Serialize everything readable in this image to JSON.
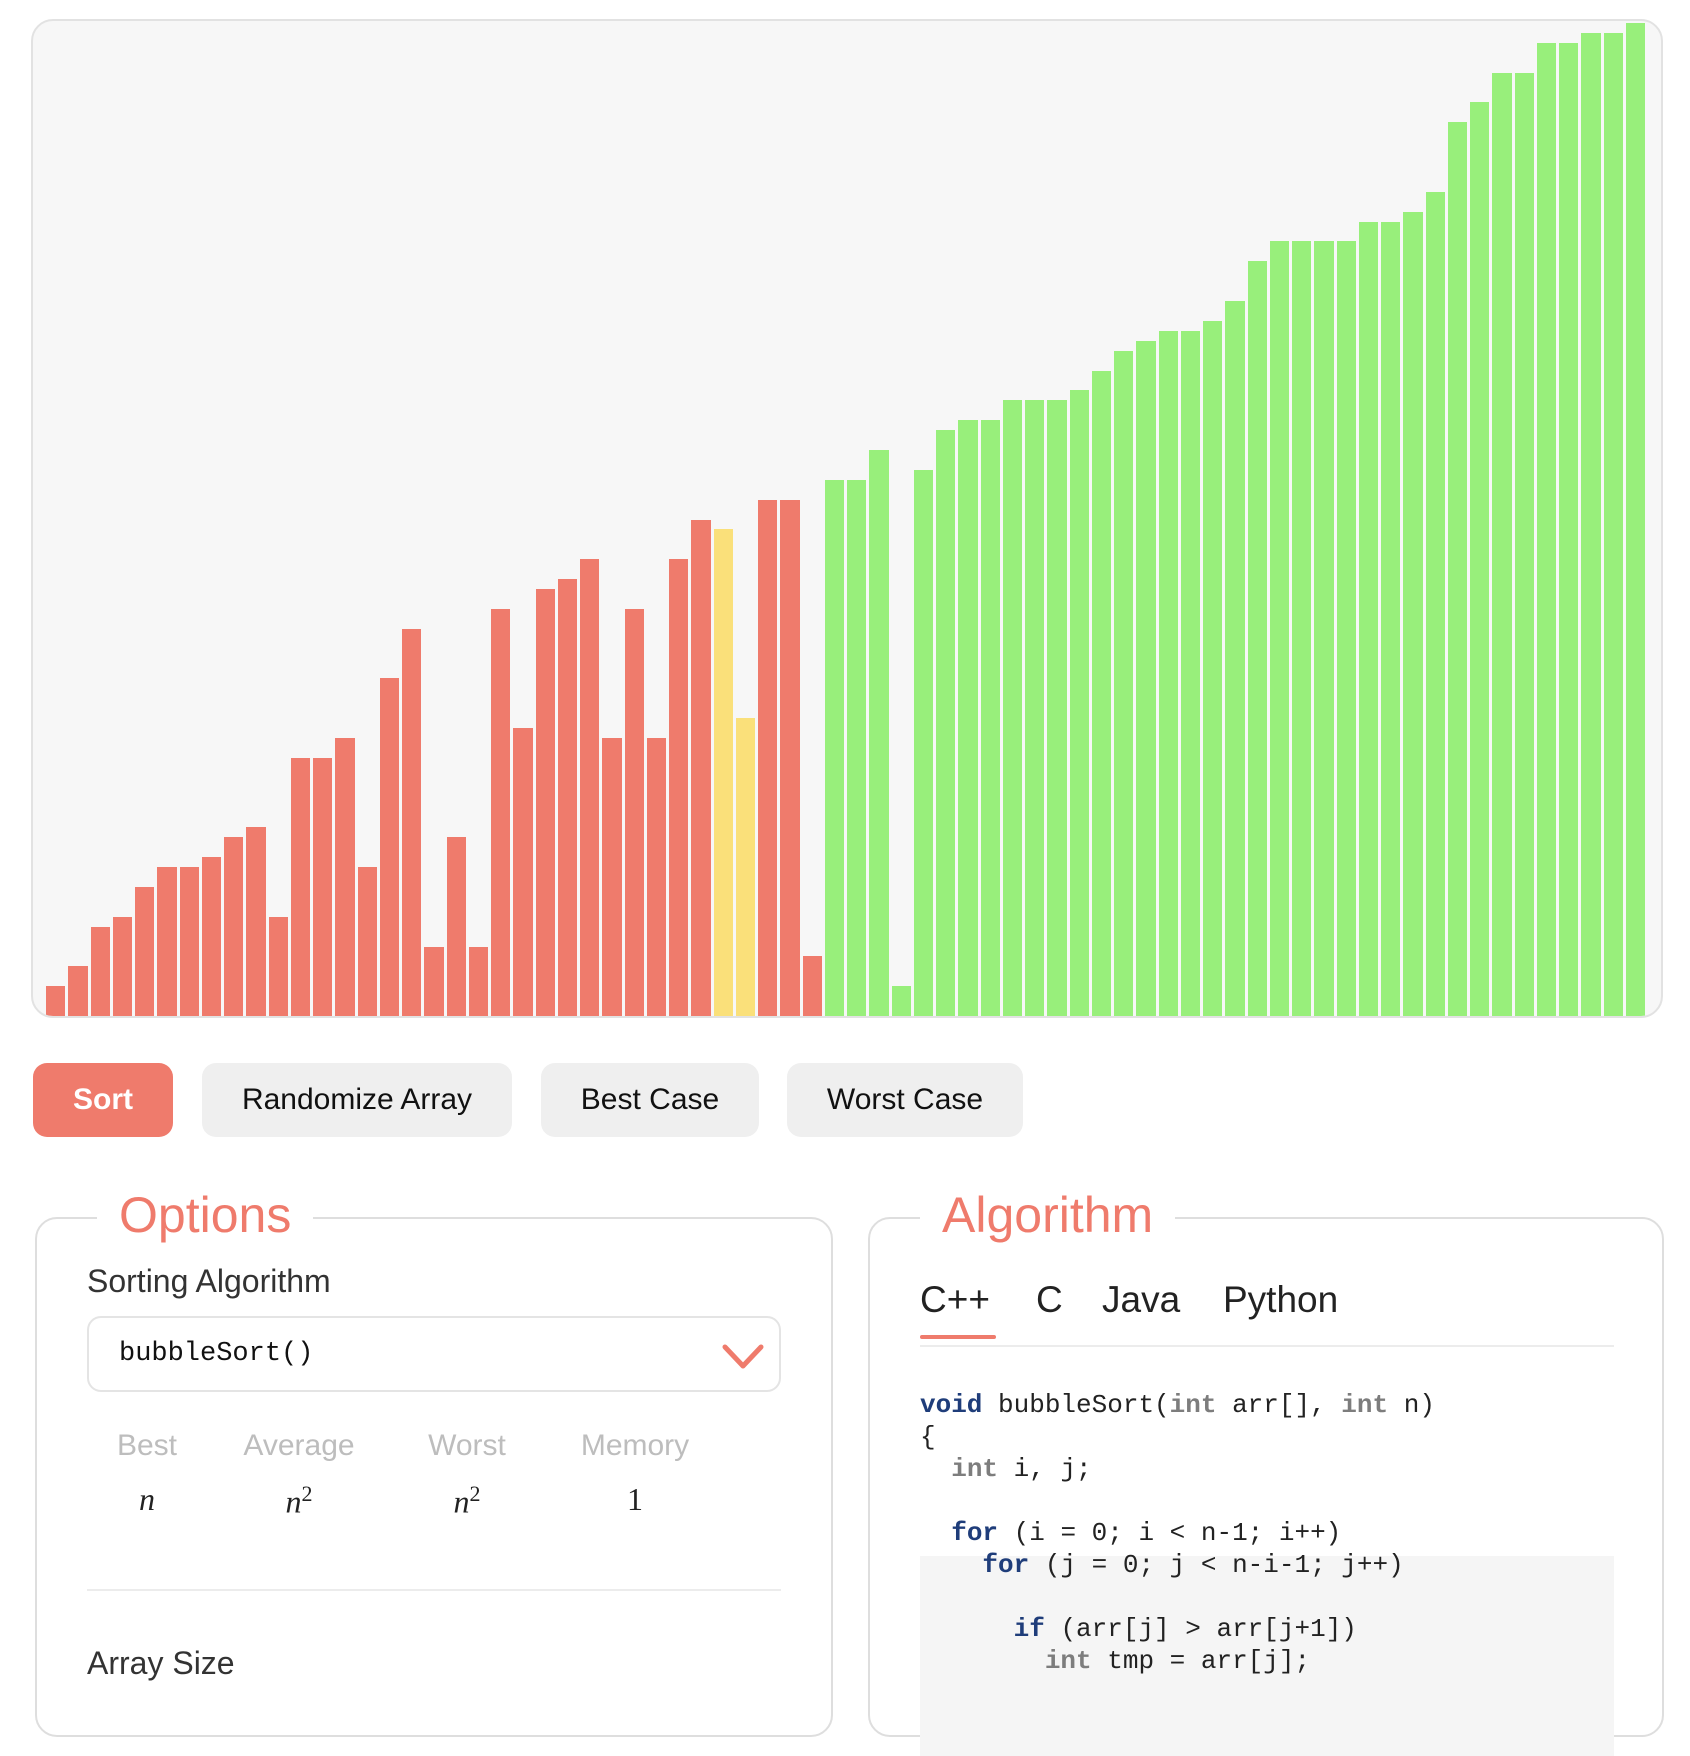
{
  "chart_data": {
    "type": "bar",
    "values": [
      3,
      5,
      9,
      10,
      13,
      15,
      15,
      16,
      18,
      19,
      10,
      26,
      26,
      28,
      15,
      34,
      39,
      7,
      18,
      7,
      41,
      29,
      43,
      44,
      46,
      28,
      41,
      28,
      46,
      50,
      49,
      30,
      52,
      52,
      6,
      54,
      54,
      57,
      3,
      55,
      59,
      60,
      60,
      62,
      62,
      62,
      63,
      65,
      67,
      68,
      69,
      69,
      70,
      72,
      76,
      78,
      78,
      78,
      78,
      80,
      80,
      81,
      83,
      90,
      92,
      95,
      95,
      98,
      98,
      99,
      99,
      100
    ],
    "ylim": [
      0,
      100
    ],
    "sorted_count": 37,
    "current_indices": [
      30,
      31
    ],
    "colors": {
      "unsorted": "#ef7b6c",
      "sorted": "#98ef7b",
      "current": "#fae07a"
    }
  },
  "buttons": {
    "sort": "Sort",
    "randomize": "Randomize Array",
    "best_case": "Best Case",
    "worst_case": "Worst Case"
  },
  "options": {
    "legend": "Options",
    "algorithm_label": "Sorting Algorithm",
    "selected_algorithm": "bubbleSort()",
    "complexity_headers": {
      "best": "Best",
      "average": "Average",
      "worst": "Worst",
      "memory": "Memory"
    },
    "complexity_values": {
      "best": "n",
      "average_base": "n",
      "average_exp": "2",
      "worst_base": "n",
      "worst_exp": "2",
      "memory": "1"
    },
    "array_size_label": "Array Size"
  },
  "algorithm": {
    "legend": "Algorithm",
    "tabs": [
      "C++",
      "C",
      "Java",
      "Python"
    ],
    "active_tab": "C++"
  },
  "colors": {
    "accent": "#ef7b6c",
    "keyword": "#1f3d7a",
    "type": "#7d7d7d"
  }
}
